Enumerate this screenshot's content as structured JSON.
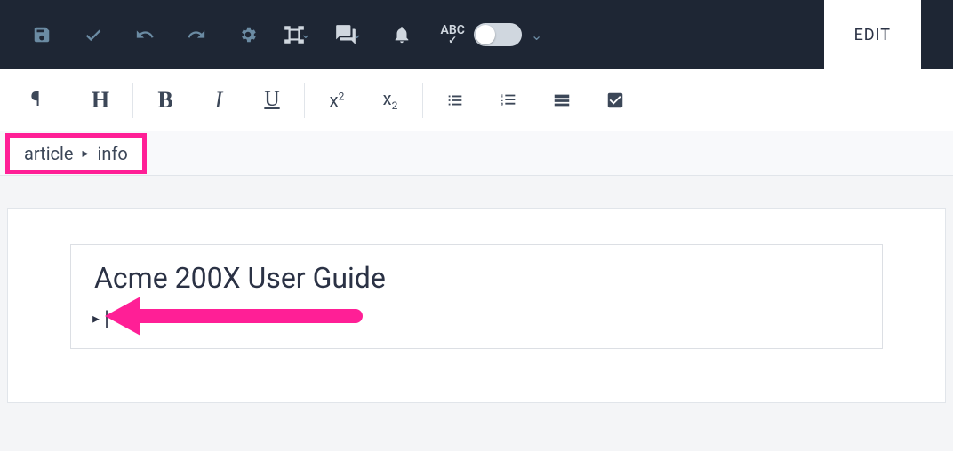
{
  "colors": {
    "brand_dark": "#1e2634",
    "accent_pink": "#ff1f96",
    "icon_blue": "#6b8ba3"
  },
  "top_toolbar": {
    "save": "save",
    "validate": "check",
    "undo": "undo",
    "redo": "redo",
    "settings": "settings",
    "layout": "layout",
    "comments": "comments",
    "notifications": "bell",
    "spellcheck_label": "ABC",
    "spellcheck_on": false,
    "more": "more",
    "edit_tab": "EDIT"
  },
  "format_toolbar": {
    "paragraph": "¶",
    "heading": "H",
    "bold": "B",
    "italic": "I",
    "underline": "U",
    "superscript_base": "x",
    "superscript_exp": "2",
    "subscript_base": "x",
    "subscript_exp": "2",
    "ulist": "ul",
    "olist": "ol",
    "layout_block": "layout",
    "checkbox": "checkbox"
  },
  "breadcrumb": {
    "items": [
      "article",
      "info"
    ],
    "separator": "▸"
  },
  "document": {
    "title": "Acme 200X User Guide",
    "cursor_glyph": "▸|"
  }
}
